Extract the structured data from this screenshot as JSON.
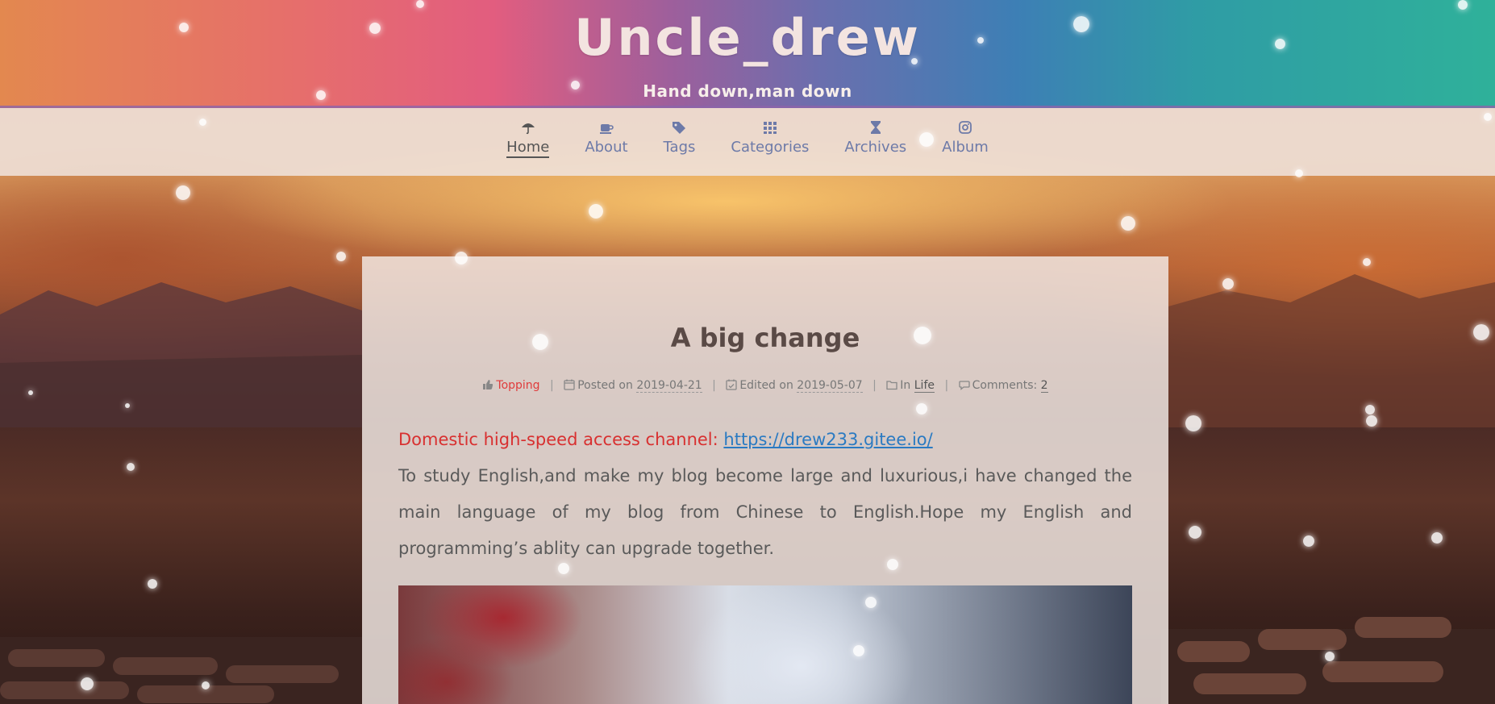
{
  "header": {
    "title": "Uncle_drew",
    "subtitle": "Hand down,man down"
  },
  "nav": {
    "items": [
      {
        "label": "Home",
        "icon": "umbrella-icon",
        "active": true
      },
      {
        "label": "About",
        "icon": "coffee-icon",
        "active": false
      },
      {
        "label": "Tags",
        "icon": "tags-icon",
        "active": false
      },
      {
        "label": "Categories",
        "icon": "grid-icon",
        "active": false
      },
      {
        "label": "Archives",
        "icon": "hourglass-icon",
        "active": false
      },
      {
        "label": "Album",
        "icon": "camera-icon",
        "active": false
      }
    ]
  },
  "post": {
    "title": "A big change",
    "meta": {
      "topping": "Topping",
      "posted_label": "Posted on",
      "posted_date": "2019-04-21",
      "edited_label": "Edited on",
      "edited_date": "2019-05-07",
      "in_label": "In",
      "category": "Life",
      "comments_label": "Comments:",
      "comments_count": "2"
    },
    "access_label": "Domestic high-speed access channel:",
    "access_url": "https://drew233.gitee.io/",
    "body": "To study English,and make my blog become large and luxurious,i have changed the main language of my blog from Chinese to English.Hope my English and programming’s ablity can upgrade together."
  },
  "colors": {
    "accent_red": "#d83030",
    "link_blue": "#2a7ac2",
    "nav_text": "#6d7aa8"
  }
}
